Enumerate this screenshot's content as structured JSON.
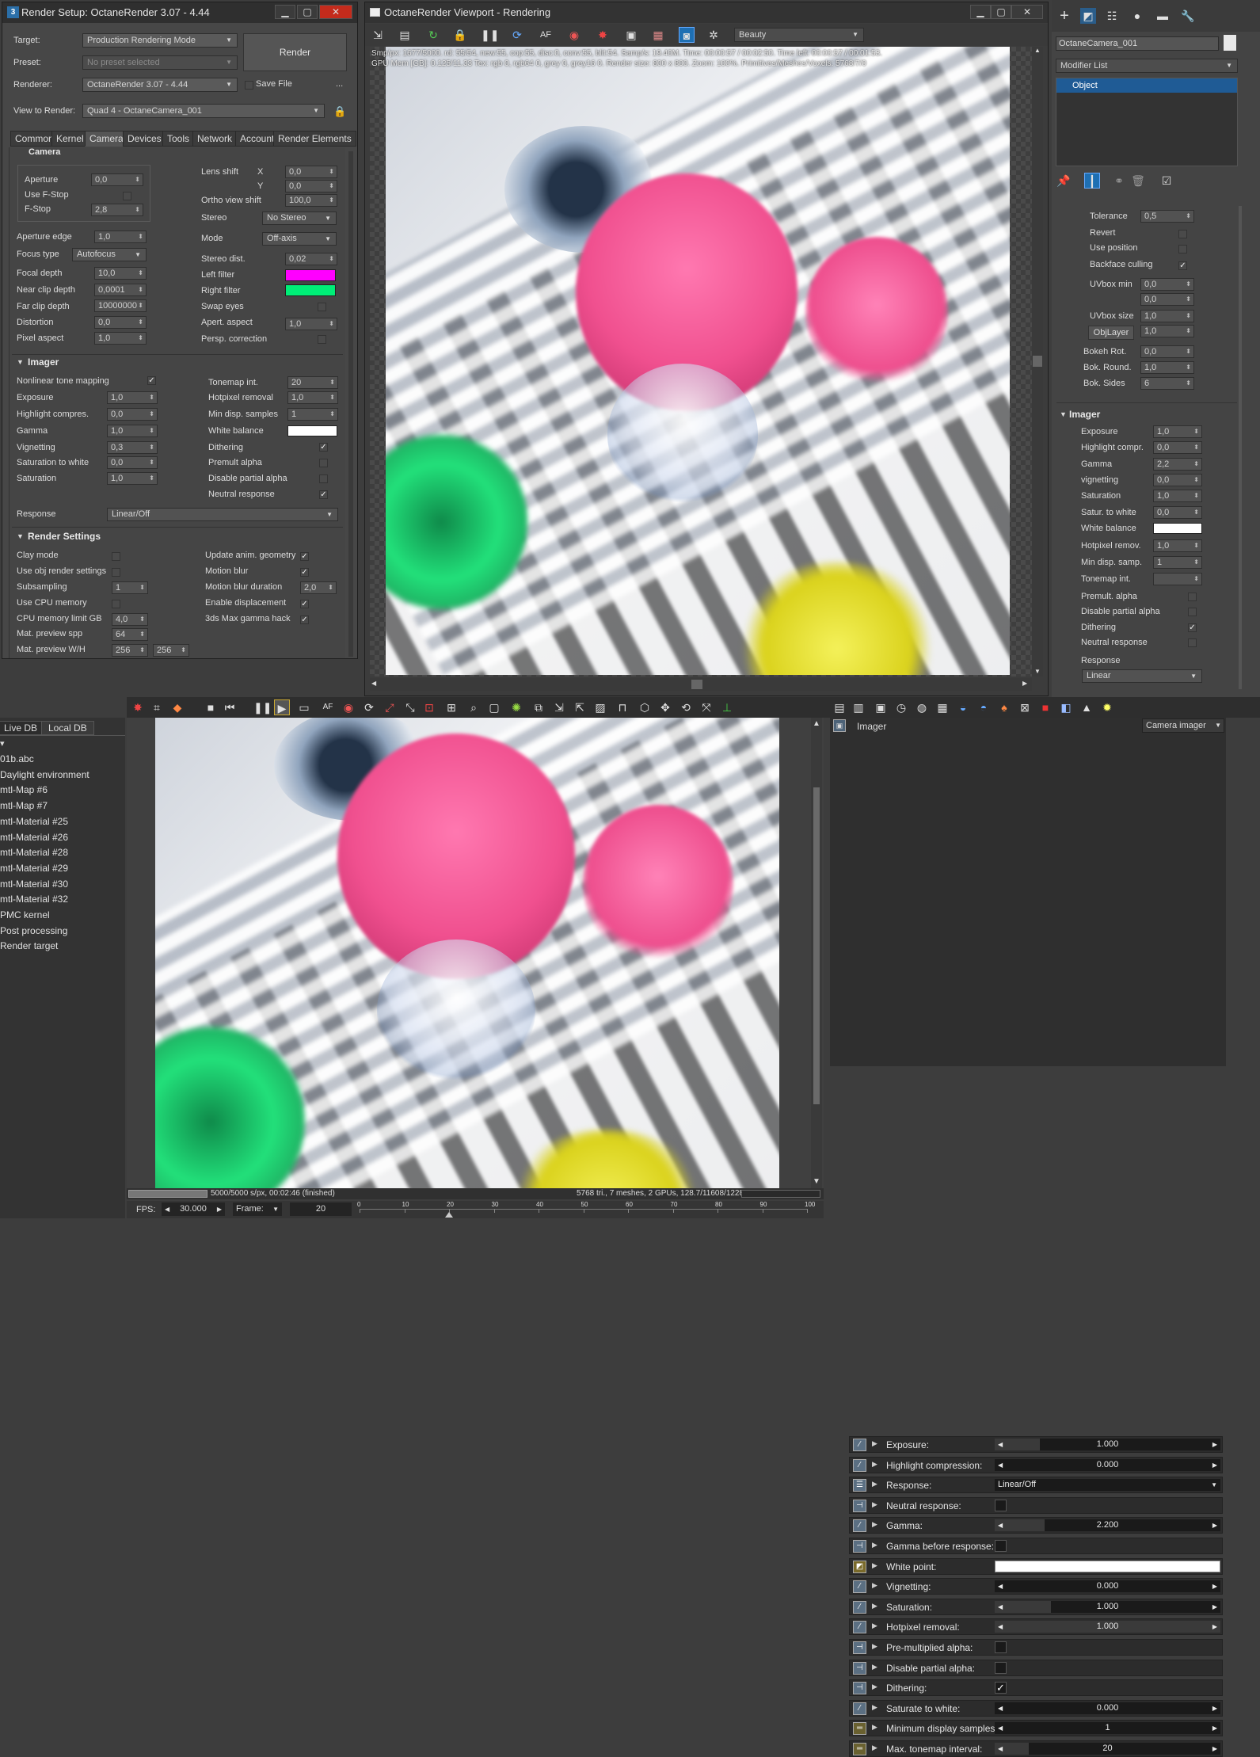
{
  "render_setup": {
    "title": "Render Setup: OctaneRender 3.07 - 4.44",
    "target_label": "Target:",
    "target_value": "Production Rendering Mode",
    "preset_label": "Preset:",
    "preset_value": "No preset selected",
    "renderer_label": "Renderer:",
    "renderer_value": "OctaneRender 3.07 - 4.44",
    "save_file": "Save File",
    "more": "...",
    "view_label": "View to Render:",
    "view_value": "Quad 4 - OctaneCamera_001",
    "render_button": "Render",
    "tabs": [
      "Common",
      "Kernel",
      "Camera",
      "Devices",
      "Tools",
      "Network",
      "Account",
      "Render Elements"
    ],
    "camera": {
      "section": "Camera",
      "aperture_label": "Aperture",
      "aperture": "0,0",
      "use_fstop_label": "Use F-Stop",
      "fstop_label": "F-Stop",
      "fstop": "2,8",
      "aperture_edge_label": "Aperture edge",
      "aperture_edge": "1,0",
      "focus_type_label": "Focus type",
      "focus_type": "Autofocus",
      "focal_depth_label": "Focal depth",
      "focal_depth": "10,0",
      "near_clip_label": "Near clip depth",
      "near_clip": "0,0001",
      "far_clip_label": "Far clip depth",
      "far_clip": "10000000",
      "distortion_label": "Distortion",
      "distortion": "0,0",
      "pixel_aspect_label": "Pixel aspect",
      "pixel_aspect": "1,0",
      "lens_shift_label": "Lens shift",
      "x_label": "X",
      "y_label": "Y",
      "lens_x": "0,0",
      "lens_y": "0,0",
      "ortho_label": "Ortho view shift",
      "ortho": "100,0",
      "stereo_label": "Stereo",
      "stereo": "No Stereo",
      "mode_label": "Mode",
      "mode": "Off-axis",
      "stereo_dist_label": "Stereo dist.",
      "stereo_dist": "0,02",
      "left_filter_label": "Left filter",
      "right_filter_label": "Right filter",
      "swap_eyes_label": "Swap eyes",
      "apert_aspect_label": "Apert. aspect",
      "apert_aspect": "1,0",
      "persp_corr_label": "Persp. correction"
    },
    "imager": {
      "section": "Imager",
      "nonlinear_label": "Nonlinear tone mapping",
      "exposure_label": "Exposure",
      "exposure": "1,0",
      "highlight_label": "Highlight compres.",
      "highlight": "0,0",
      "gamma_label": "Gamma",
      "gamma": "1,0",
      "vignetting_label": "Vignetting",
      "vignetting": "0,3",
      "sat_white_label": "Saturation to white",
      "sat_white": "0,0",
      "saturation_label": "Saturation",
      "saturation": "1,0",
      "tonemap_label": "Tonemap int.",
      "tonemap": "20",
      "hotpixel_label": "Hotpixel removal",
      "hotpixel": "1,0",
      "min_disp_label": "Min disp. samples",
      "min_disp": "1",
      "white_balance_label": "White balance",
      "dithering_label": "Dithering",
      "premult_label": "Premult alpha",
      "disable_partial_label": "Disable partial alpha",
      "neutral_label": "Neutral response",
      "response_label": "Response",
      "response": "Linear/Off"
    },
    "render_settings": {
      "section": "Render Settings",
      "clay_label": "Clay mode",
      "use_obj_label": "Use obj render settings",
      "subsampling_label": "Subsampling",
      "subsampling": "1",
      "use_cpu_label": "Use CPU memory",
      "cpu_limit_label": "CPU memory limit GB",
      "cpu_limit": "4,0",
      "mat_spp_label": "Mat. preview spp",
      "mat_spp": "64",
      "mat_wh_label": "Mat. preview W/H",
      "mat_w": "256",
      "mat_h": "256",
      "update_anim_label": "Update anim. geometry",
      "motion_blur_label": "Motion blur",
      "motion_dur_label": "Motion blur duration",
      "motion_dur": "2,0",
      "enable_disp_label": "Enable displacement",
      "gamma_hack_label": "3ds Max gamma hack"
    }
  },
  "viewport": {
    "title": "OctaneRender Viewport - Rendering",
    "pass": "Beauty",
    "stats_line1": "Smp/px: 1677/5000.   rd: 55/54,   new:55, cop:55, disc:0, conv:55, blit:54.   Samp/s: 19.40M.   Time: 00:00:57 / 00:02:50.   Time left: 00:00:57 / 00:01:53.",
    "stats_line2": "GPU Mem [GB]: 0.125/11.33   Tex: rgb 0, rgb64 0, grey 0, grey16 0.   Render size: 800 x 800.   Zoom: 100%.   Primitives/Meshes/Voxels: 5768/7/0"
  },
  "command_panel": {
    "object_name": "OctaneCamera_001",
    "modifier_list": "Modifier List",
    "stack_item": "Object",
    "tolerance_label": "Tolerance",
    "tolerance": "0,5",
    "revert_label": "Revert",
    "use_position_label": "Use position",
    "backface_label": "Backface culling",
    "uvbox_min_label": "UVbox min",
    "uvbox_min_1": "0,0",
    "uvbox_min_2": "0,0",
    "uvbox_size_label": "UVbox size",
    "uvbox_size_1": "1,0",
    "uvbox_size_2": "1,0",
    "objlayer_label": "ObjLayer",
    "bokeh_rot_label": "Bokeh Rot.",
    "bokeh_rot": "0,0",
    "bok_round_label": "Bok. Round.",
    "bok_round": "1,0",
    "bok_sides_label": "Bok. Sides",
    "bok_sides": "6",
    "imager_section": "Imager",
    "exposure_label": "Exposure",
    "exposure": "1,0",
    "highlight_label": "Highlight compr.",
    "highlight": "0,0",
    "gamma_label": "Gamma",
    "gamma": "2,2",
    "vignetting_label": "vignetting",
    "vignetting": "0,0",
    "saturation_label": "Saturation",
    "saturation": "1,0",
    "satur_white_label": "Satur. to white",
    "satur_white": "0,0",
    "white_balance_label": "White balance",
    "hotpixel_label": "Hotpixel remov.",
    "hotpixel": "1,0",
    "min_disp_label": "Min disp. samp.",
    "min_disp": "1",
    "tonemap_label": "Tonemap int.",
    "premult_label": "Premult. alpha",
    "disable_partial_label": "Disable partial alpha",
    "dithering_label": "Dithering",
    "neutral_label": "Neutral response",
    "response_label": "Response",
    "response": "Linear"
  },
  "standalone": {
    "db_tabs": [
      "Live DB",
      "Local DB"
    ],
    "db_items": [
      "01b.abc",
      "Daylight environment",
      "mtl-Map #6",
      "mtl-Map #7",
      "mtl-Material #25",
      "mtl-Material #26",
      "mtl-Material #28",
      "mtl-Material #29",
      "mtl-Material #30",
      "mtl-Material #32",
      "PMC kernel",
      "Post processing",
      "Render target"
    ],
    "status_left": "5000/5000 s/px, 00:02:46 (finished)",
    "status_right": "5768 tri., 7 meshes, 2 GPUs, 128.7/11608/12288 MB",
    "fps_label": "FPS:",
    "fps": "30.000",
    "frame_label": "Frame:",
    "frame": "20",
    "timeline_ticks": [
      "0",
      "10",
      "20",
      "30",
      "40",
      "50",
      "60",
      "70",
      "80",
      "90",
      "100"
    ],
    "timeline_frame": 20,
    "inspector_title": "Imager",
    "inspector_dropdown": "Camera imager",
    "rows": [
      {
        "label": "Exposure:",
        "value": "1.000",
        "type": "slider",
        "fill": 0.2
      },
      {
        "label": "Highlight compression:",
        "value": "0.000",
        "type": "slider",
        "fill": 0
      },
      {
        "label": "Response:",
        "value": "Linear/Off",
        "type": "dropdown"
      },
      {
        "label": "Neutral response:",
        "type": "check",
        "checked": ""
      },
      {
        "label": "Gamma:",
        "value": "2.200",
        "type": "slider",
        "fill": 0.22
      },
      {
        "label": "Gamma before response:",
        "type": "check",
        "checked": ""
      },
      {
        "label": "White point:",
        "type": "color"
      },
      {
        "label": "Vignetting:",
        "value": "0.000",
        "type": "slider",
        "fill": 0
      },
      {
        "label": "Saturation:",
        "value": "1.000",
        "type": "slider",
        "fill": 0.25
      },
      {
        "label": "Hotpixel removal:",
        "value": "1.000",
        "type": "slider",
        "fill": 1
      },
      {
        "label": "Pre-multiplied alpha:",
        "type": "check",
        "checked": ""
      },
      {
        "label": "Disable partial alpha:",
        "type": "check",
        "checked": ""
      },
      {
        "label": "Dithering:",
        "type": "check",
        "checked": "✓"
      },
      {
        "label": "Saturate to white:",
        "value": "0.000",
        "type": "slider",
        "fill": 0
      },
      {
        "label": "Minimum display samples:",
        "value": "1",
        "type": "slider",
        "fill": 0
      },
      {
        "label": "Max. tonemap interval:",
        "value": "20",
        "type": "slider",
        "fill": 0.15
      }
    ]
  },
  "colors": {
    "left_filter": "#ff00ff",
    "right_filter": "#00ee77",
    "accent": "#1e6fb3"
  }
}
